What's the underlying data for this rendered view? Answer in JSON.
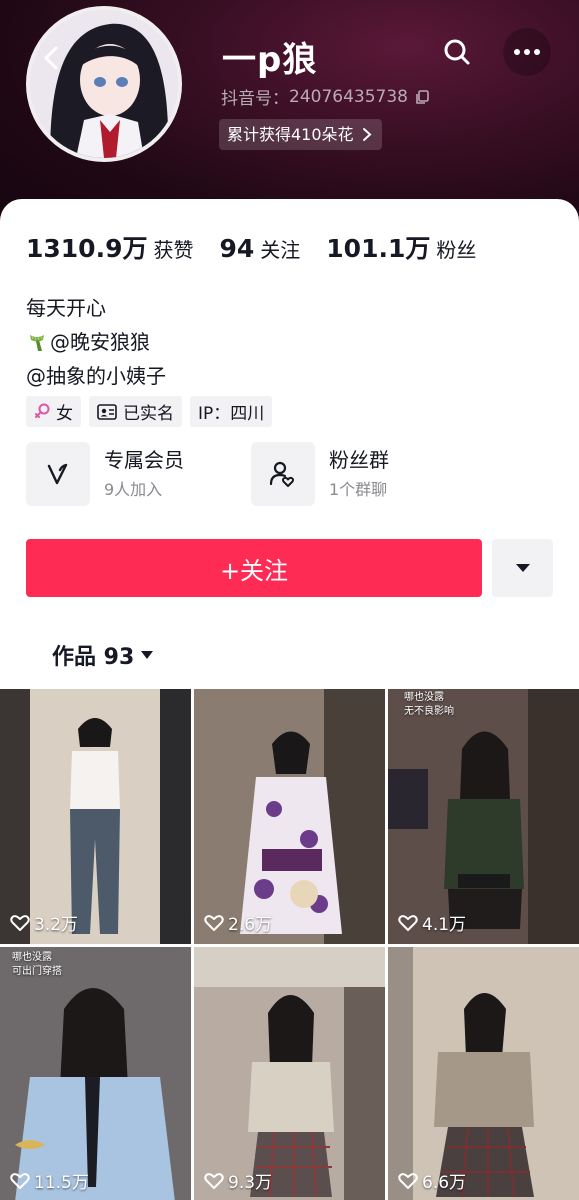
{
  "profile": {
    "nickname": "一p狼",
    "douyin_id_label": "抖音号：",
    "douyin_id": "24076435738",
    "flowers_text": "累计获得410朵花"
  },
  "stats": [
    {
      "value": "1310.9万",
      "label": "获赞"
    },
    {
      "value": "94",
      "label": "关注"
    },
    {
      "value": "101.1万",
      "label": "粉丝"
    }
  ],
  "bio": {
    "line1": "每天开心",
    "line2": "@晚安狼狼",
    "line3": "@抽象的小姨子"
  },
  "tags": {
    "gender": "女",
    "verified": "已实名",
    "ip": "IP：四川"
  },
  "entries": {
    "member": {
      "title": "专属会员",
      "sub": "9人加入"
    },
    "fans_group": {
      "title": "粉丝群",
      "sub": "1个群聊"
    }
  },
  "actions": {
    "follow_label": "+关注"
  },
  "works": {
    "tab_label": "作品 93"
  },
  "videos": [
    {
      "likes": "3.2万"
    },
    {
      "likes": "2.6万"
    },
    {
      "likes": "4.1万",
      "overlay": [
        "哪也没露",
        "无不良影响"
      ]
    },
    {
      "likes": "11.5万",
      "overlay": [
        "哪也没露",
        "可出门穿搭"
      ]
    },
    {
      "likes": "9.3万"
    },
    {
      "likes": "6.6万"
    }
  ],
  "colors": {
    "accent": "#fe2c55",
    "header_bg": "#2a0b1b"
  },
  "icons": [
    "back-icon",
    "search-icon",
    "more-icon",
    "copy-icon",
    "chevron-right-icon",
    "scarf-icon",
    "female-icon",
    "id-card-icon",
    "member-v-icon",
    "fans-group-icon",
    "dropdown-caret-icon",
    "heart-icon"
  ]
}
